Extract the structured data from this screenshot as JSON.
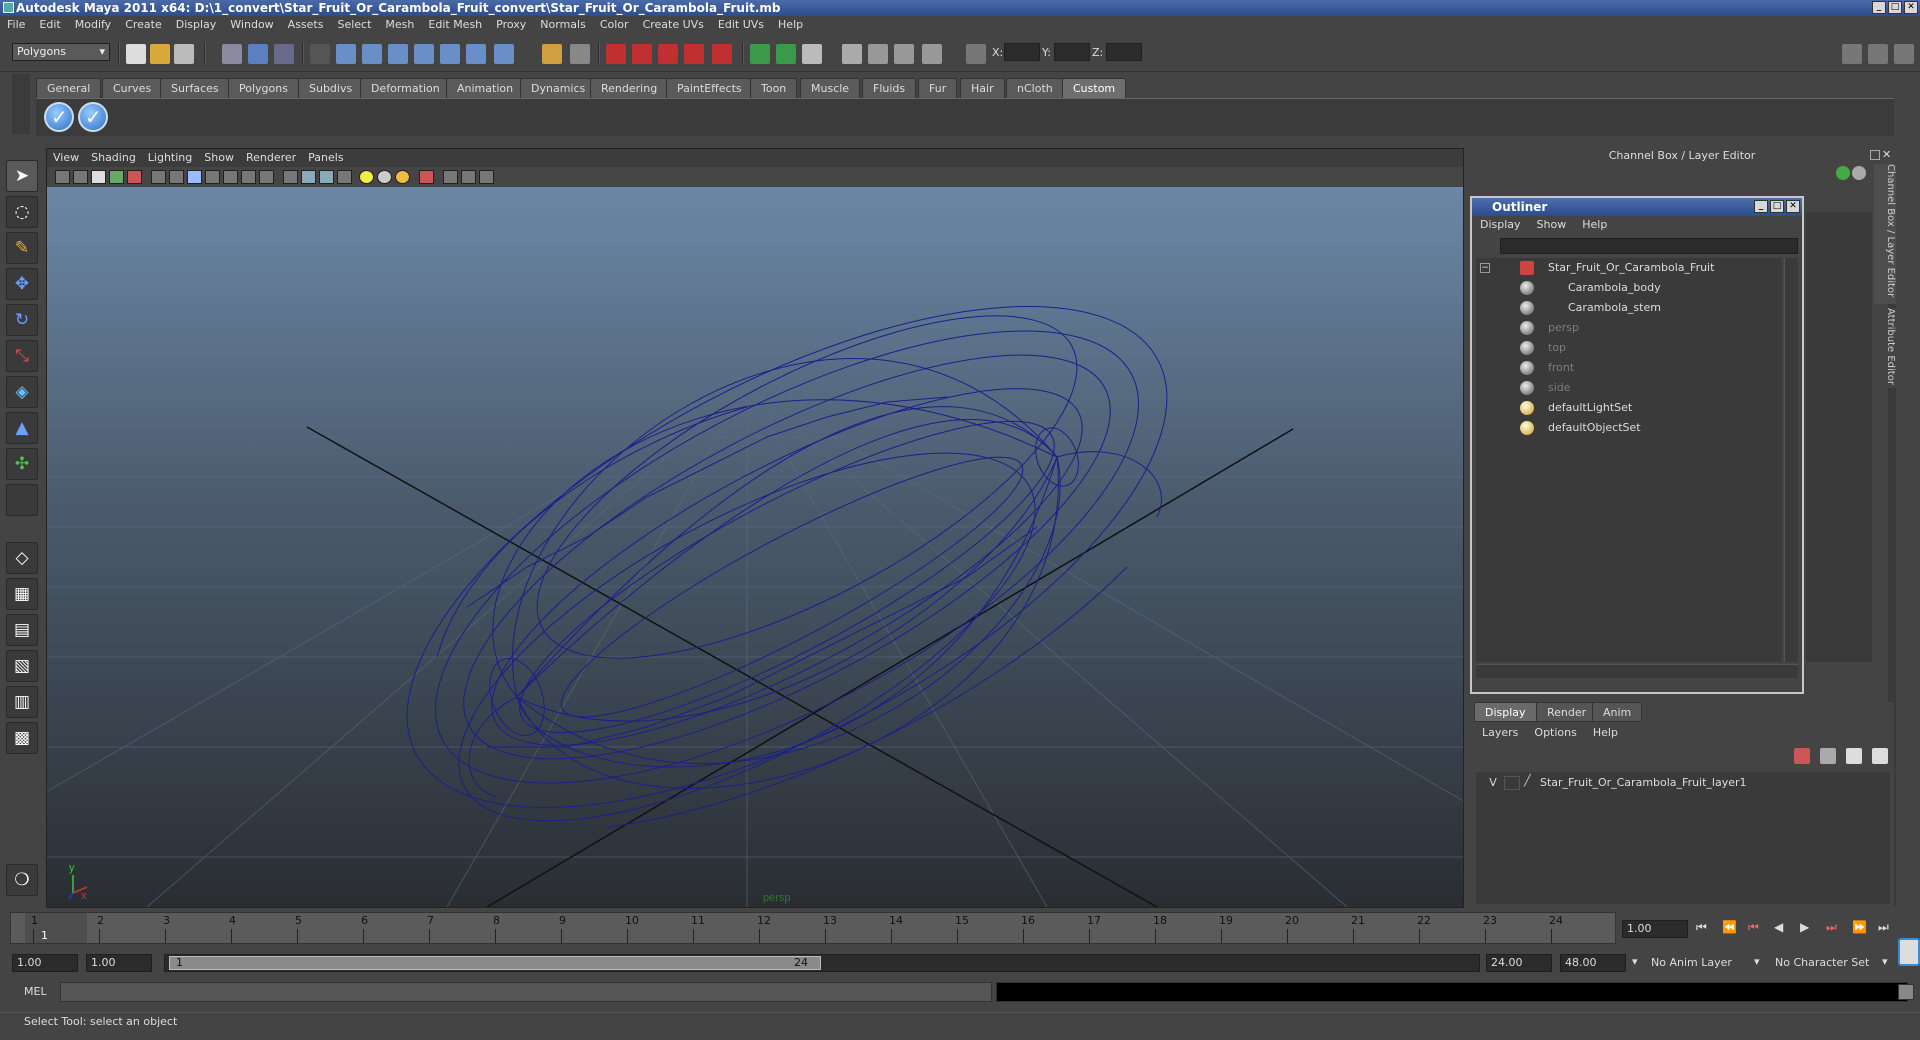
{
  "window": {
    "title": "Autodesk Maya 2011 x64: D:\\1_convert\\Star_Fruit_Or_Carambola_Fruit_convert\\Star_Fruit_Or_Carambola_Fruit.mb"
  },
  "menus": [
    "File",
    "Edit",
    "Modify",
    "Create",
    "Display",
    "Window",
    "Assets",
    "Select",
    "Mesh",
    "Edit Mesh",
    "Proxy",
    "Normals",
    "Color",
    "Create UVs",
    "Edit UVs",
    "Help"
  ],
  "status": {
    "mode": "Polygons",
    "x_label": "X:",
    "y_label": "Y:",
    "z_label": "Z:"
  },
  "shelf_tabs": [
    "General",
    "Curves",
    "Surfaces",
    "Polygons",
    "Subdivs",
    "Deformation",
    "Animation",
    "Dynamics",
    "Rendering",
    "PaintEffects",
    "Toon",
    "Muscle",
    "Fluids",
    "Fur",
    "Hair",
    "nCloth",
    "Custom"
  ],
  "active_shelf_tab": "Custom",
  "viewport": {
    "menu": [
      "View",
      "Shading",
      "Lighting",
      "Show",
      "Renderer",
      "Panels"
    ],
    "camera_label": "persp",
    "axis_y": "y",
    "axis_x": "x"
  },
  "channel_box": {
    "title": "Channel Box / Layer Editor",
    "side_tab_1": "Channel Box / Layer Editor",
    "side_tab_2": "Attribute Editor"
  },
  "outliner": {
    "title": "Outliner",
    "menu": [
      "Display",
      "Show",
      "Help"
    ],
    "items": [
      {
        "label": "Star_Fruit_Or_Carambola_Fruit",
        "dim": false
      },
      {
        "label": "Carambola_body",
        "dim": false
      },
      {
        "label": "Carambola_stem",
        "dim": false
      },
      {
        "label": "persp",
        "dim": true
      },
      {
        "label": "top",
        "dim": true
      },
      {
        "label": "front",
        "dim": true
      },
      {
        "label": "side",
        "dim": true
      },
      {
        "label": "defaultLightSet",
        "dim": false
      },
      {
        "label": "defaultObjectSet",
        "dim": false
      }
    ]
  },
  "layer_editor": {
    "tabs": [
      "Display",
      "Render",
      "Anim"
    ],
    "menu": [
      "Layers",
      "Options",
      "Help"
    ],
    "layer_visible": "V",
    "layer_name": "Star_Fruit_Or_Carambola_Fruit_layer1"
  },
  "timeline": {
    "ticks": [
      "1",
      "2",
      "3",
      "4",
      "5",
      "6",
      "7",
      "8",
      "9",
      "10",
      "11",
      "12",
      "13",
      "14",
      "15",
      "16",
      "17",
      "18",
      "19",
      "20",
      "21",
      "22",
      "23",
      "24"
    ],
    "current_frame_marker": "1",
    "current_time": "1.00"
  },
  "range": {
    "start": "1.00",
    "playback_start": "1.00",
    "slider_start": "1",
    "slider_end": "24",
    "playback_end": "24.00",
    "end": "48.00",
    "anim_layer": "No Anim Layer",
    "character_set": "No Character Set"
  },
  "command": {
    "label": "MEL"
  },
  "help_line": "Select Tool: select an object",
  "colors": {
    "wireframe": "#1c1f8a",
    "title_bar": "#2c4c8c",
    "active_tab": "#6e6e6e"
  }
}
